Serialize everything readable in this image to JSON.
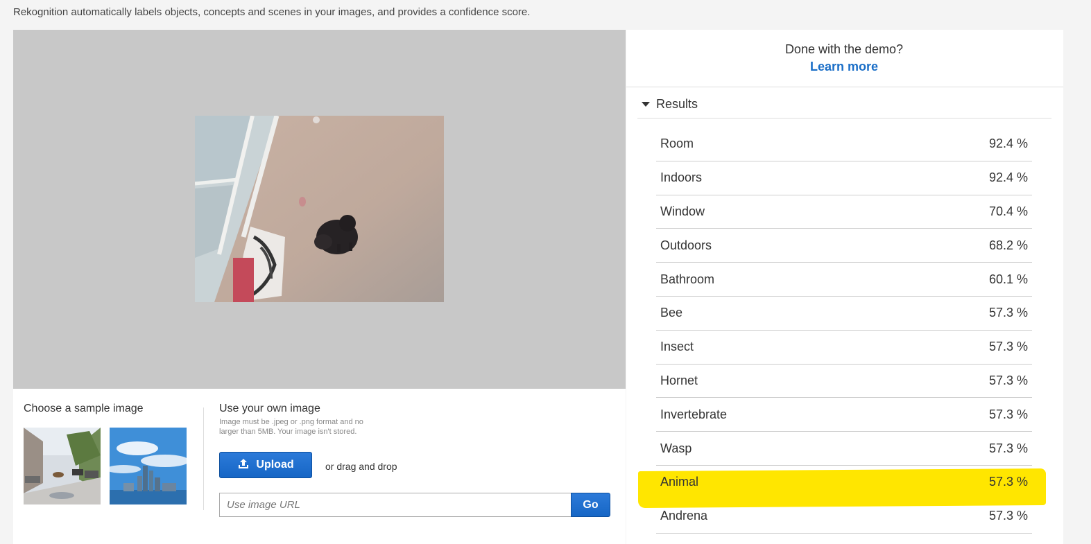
{
  "intro_text": "Rekognition automatically labels objects, concepts and scenes in your images, and provides a confidence score.",
  "sample": {
    "heading": "Choose a sample image"
  },
  "own_image": {
    "heading": "Use your own image",
    "note": "Image must be .jpeg or .png format and no larger than 5MB. Your image isn't stored.",
    "upload_label": "Upload",
    "drag_label": "or drag and drop",
    "url_placeholder": "Use image URL",
    "go_label": "Go"
  },
  "sidebar": {
    "done_text": "Done with the demo?",
    "learn_more": "Learn more",
    "results_label": "Results",
    "results": [
      {
        "name": "Room",
        "confidence": "92.4 %"
      },
      {
        "name": "Indoors",
        "confidence": "92.4 %"
      },
      {
        "name": "Window",
        "confidence": "70.4 %"
      },
      {
        "name": "Outdoors",
        "confidence": "68.2 %"
      },
      {
        "name": "Bathroom",
        "confidence": "60.1 %"
      },
      {
        "name": "Bee",
        "confidence": "57.3 %"
      },
      {
        "name": "Insect",
        "confidence": "57.3 %"
      },
      {
        "name": "Hornet",
        "confidence": "57.3 %"
      },
      {
        "name": "Invertebrate",
        "confidence": "57.3 %"
      },
      {
        "name": "Wasp",
        "confidence": "57.3 %"
      },
      {
        "name": "Animal",
        "confidence": "57.3 %"
      },
      {
        "name": "Andrena",
        "confidence": "57.3 %"
      }
    ]
  },
  "colors": {
    "accent": "#1a6ec7",
    "button": "#1666c5",
    "highlight": "#ffe600"
  }
}
